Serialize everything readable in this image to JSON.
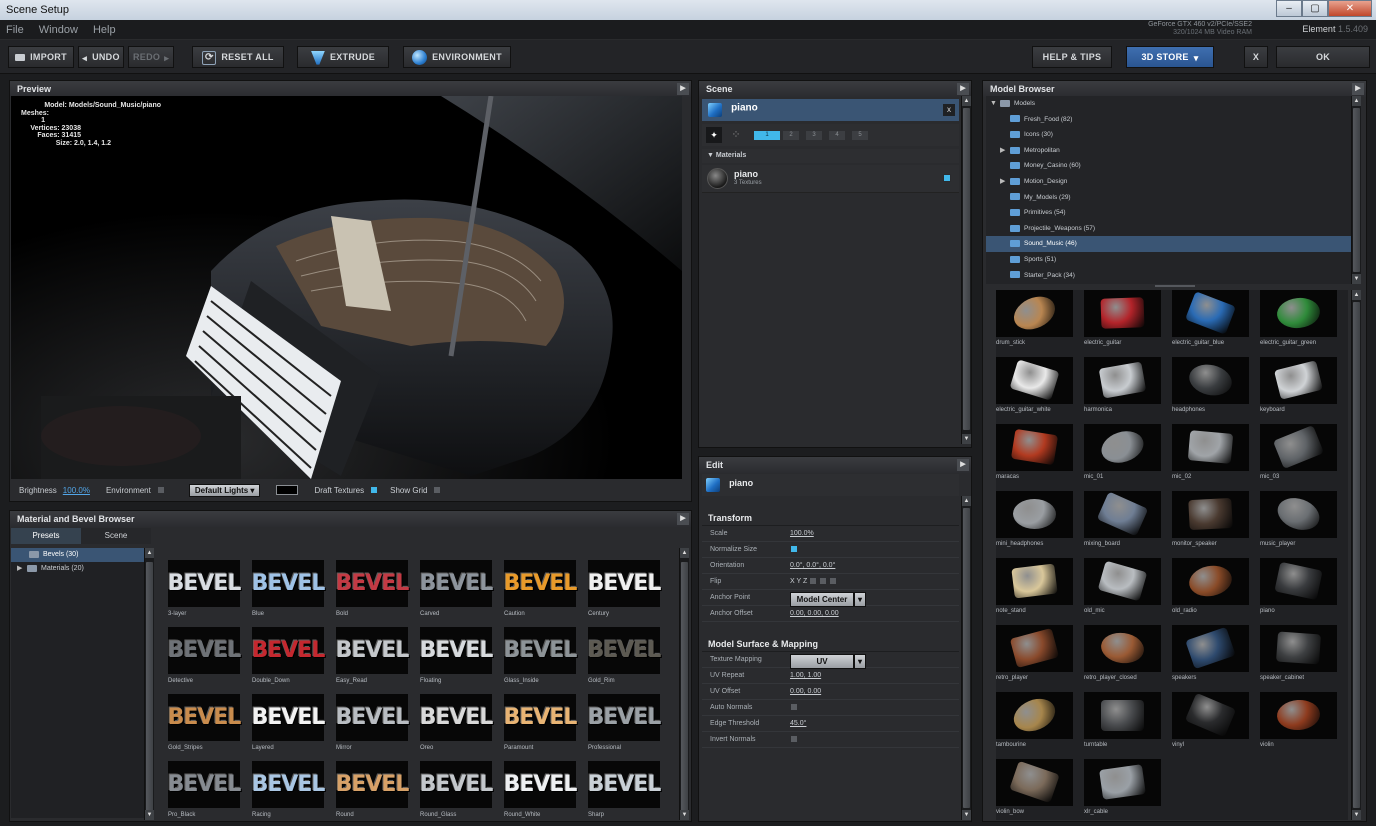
{
  "window": {
    "title": "Scene Setup",
    "min": "–",
    "max": "▢",
    "close": "✕"
  },
  "menu": [
    "File",
    "Window",
    "Help"
  ],
  "gpu": {
    "line1": "GeForce GTX 460 v2/PCIe/SSE2",
    "line2": "320/1024 MB Video RAM"
  },
  "element": {
    "name": "Element",
    "version": "1.5.409"
  },
  "toolbar": {
    "import": "IMPORT",
    "undo": "UNDO",
    "redo": "REDO",
    "reset_all": "RESET ALL",
    "extrude": "EXTRUDE",
    "environment": "ENVIRONMENT",
    "help_tips": "HELP & TIPS",
    "store": "3D STORE",
    "x": "X",
    "ok": "OK"
  },
  "preview": {
    "title": "Preview",
    "stats": [
      "Model: Models/Sound_Music/piano",
      "Meshes: 1",
      "Vertices: 23038",
      "Faces: 31415",
      "Size: 2.0, 1.4, 1.2"
    ],
    "brightness_label": "Brightness",
    "brightness_value": "100.0%",
    "environment_label": "Environment",
    "lights": "Default Lights",
    "draft_textures_label": "Draft Textures",
    "show_grid_label": "Show Grid"
  },
  "material_browser": {
    "title": "Material and Bevel Browser",
    "tabs": [
      "Presets",
      "Scene"
    ],
    "tree": [
      "Bevels (30)",
      "Materials (20)"
    ],
    "bevel_word": "BEVEL",
    "bevels": [
      {
        "name": "3-layer",
        "color": "#d9dde2"
      },
      {
        "name": "Blue",
        "color": "#9fc2e6"
      },
      {
        "name": "Bold",
        "color": "#c33a44"
      },
      {
        "name": "Carved",
        "color": "#8d949c"
      },
      {
        "name": "Caution",
        "color": "#e89a2a"
      },
      {
        "name": "Century",
        "color": "#f0f0f0"
      },
      {
        "name": "Detective",
        "color": "#6e7277"
      },
      {
        "name": "Double_Down",
        "color": "#c4282f"
      },
      {
        "name": "Easy_Read",
        "color": "#c4c7cb"
      },
      {
        "name": "Floating",
        "color": "#d7dadd"
      },
      {
        "name": "Glass_Inside",
        "color": "#8d9397"
      },
      {
        "name": "Gold_Rim",
        "color": "#5d5a52"
      },
      {
        "name": "Gold_Stripes",
        "color": "#c98c4d"
      },
      {
        "name": "Layered",
        "color": "#f2f2f2"
      },
      {
        "name": "Mirror",
        "color": "#b9bdc2"
      },
      {
        "name": "Oreo",
        "color": "#d8d8d8"
      },
      {
        "name": "Paramount",
        "color": "#e8b474"
      },
      {
        "name": "Professional",
        "color": "#9ba1a6"
      },
      {
        "name": "Pro_Black",
        "color": "#868b91"
      },
      {
        "name": "Racing",
        "color": "#a9c6e3"
      },
      {
        "name": "Round",
        "color": "#d7a168"
      },
      {
        "name": "Round_Glass",
        "color": "#c3c7cb"
      },
      {
        "name": "Round_White",
        "color": "#eef0f2"
      },
      {
        "name": "Sharp",
        "color": "#c9d0d6"
      }
    ]
  },
  "scene": {
    "title": "Scene",
    "object": "piano",
    "close": "x",
    "layers": [
      "1",
      "2",
      "3",
      "4",
      "5"
    ],
    "materials_label": "Materials",
    "material_name": "piano",
    "material_sub": "3 Textures"
  },
  "edit": {
    "title": "Edit",
    "object": "piano",
    "transform_title": "Transform",
    "transform": [
      {
        "label": "Scale",
        "value": "100.0%"
      },
      {
        "label": "Normalize Size",
        "value": ""
      },
      {
        "label": "Orientation",
        "value": "0.0°, 0.0°, 0.0°"
      },
      {
        "label": "Flip",
        "value": "X  Y  Z"
      },
      {
        "label": "Anchor Point",
        "value": "Model Center"
      },
      {
        "label": "Anchor Offset",
        "value": "0.00, 0.00, 0.00"
      }
    ],
    "surface_title": "Model Surface & Mapping",
    "surface": [
      {
        "label": "Texture Mapping",
        "value": "UV"
      },
      {
        "label": "UV Repeat",
        "value": "1.00, 1.00"
      },
      {
        "label": "UV Offset",
        "value": "0.00, 0.00"
      },
      {
        "label": "Auto Normals",
        "value": ""
      },
      {
        "label": "Edge Threshold",
        "value": "45.0°"
      },
      {
        "label": "Invert Normals",
        "value": ""
      }
    ]
  },
  "model_browser": {
    "title": "Model Browser",
    "root": "Models",
    "folders": [
      {
        "name": "Fresh_Food (82)",
        "expandable": false
      },
      {
        "name": "Icons (30)",
        "expandable": false
      },
      {
        "name": "Metropolitan",
        "expandable": true
      },
      {
        "name": "Money_Casino (60)",
        "expandable": false
      },
      {
        "name": "Motion_Design",
        "expandable": true
      },
      {
        "name": "My_Models (29)",
        "expandable": false
      },
      {
        "name": "Primitives (54)",
        "expandable": false
      },
      {
        "name": "Projectile_Weapons (57)",
        "expandable": false
      },
      {
        "name": "Sound_Music (46)",
        "expandable": false,
        "selected": true
      },
      {
        "name": "Sports (51)",
        "expandable": false
      },
      {
        "name": "Starter_Pack (34)",
        "expandable": false
      }
    ],
    "models": [
      {
        "name": "drum_stick",
        "color": "#b98651"
      },
      {
        "name": "electric_guitar",
        "color": "#b3242a"
      },
      {
        "name": "electric_guitar_blue",
        "color": "#2a6bb5"
      },
      {
        "name": "electric_guitar_green",
        "color": "#2f8b3a"
      },
      {
        "name": "electric_guitar_white",
        "color": "#e9e9e9"
      },
      {
        "name": "harmonica",
        "color": "#c8ccd0"
      },
      {
        "name": "headphones",
        "color": "#3a3d40"
      },
      {
        "name": "keyboard",
        "color": "#d0d3d6"
      },
      {
        "name": "maracas",
        "color": "#b23a20"
      },
      {
        "name": "mic_01",
        "color": "#8a8f94"
      },
      {
        "name": "mic_02",
        "color": "#a0a4a8"
      },
      {
        "name": "mic_03",
        "color": "#5f6367"
      },
      {
        "name": "mini_headphones",
        "color": "#9a9ea2"
      },
      {
        "name": "mixing_board",
        "color": "#6f7e94"
      },
      {
        "name": "monitor_speaker",
        "color": "#4a3a30"
      },
      {
        "name": "music_player",
        "color": "#6a6e72"
      },
      {
        "name": "note_stand",
        "color": "#d9c79a"
      },
      {
        "name": "old_mic",
        "color": "#b9bdc1"
      },
      {
        "name": "old_radio",
        "color": "#8a4b28"
      },
      {
        "name": "piano",
        "color": "#3a3c3f"
      },
      {
        "name": "retro_player",
        "color": "#8a4a2c"
      },
      {
        "name": "retro_player_closed",
        "color": "#9a5a34"
      },
      {
        "name": "speakers",
        "color": "#2e4a6e"
      },
      {
        "name": "speaker_cabinet",
        "color": "#3e4042"
      },
      {
        "name": "tambourine",
        "color": "#a7864c"
      },
      {
        "name": "turntable",
        "color": "#4a4c4f"
      },
      {
        "name": "vinyl",
        "color": "#2a2b2d"
      },
      {
        "name": "violin",
        "color": "#8e3b1e"
      },
      {
        "name": "violin_bow",
        "color": "#7b6a5a"
      },
      {
        "name": "xlr_cable",
        "color": "#9aa0a6"
      }
    ]
  }
}
